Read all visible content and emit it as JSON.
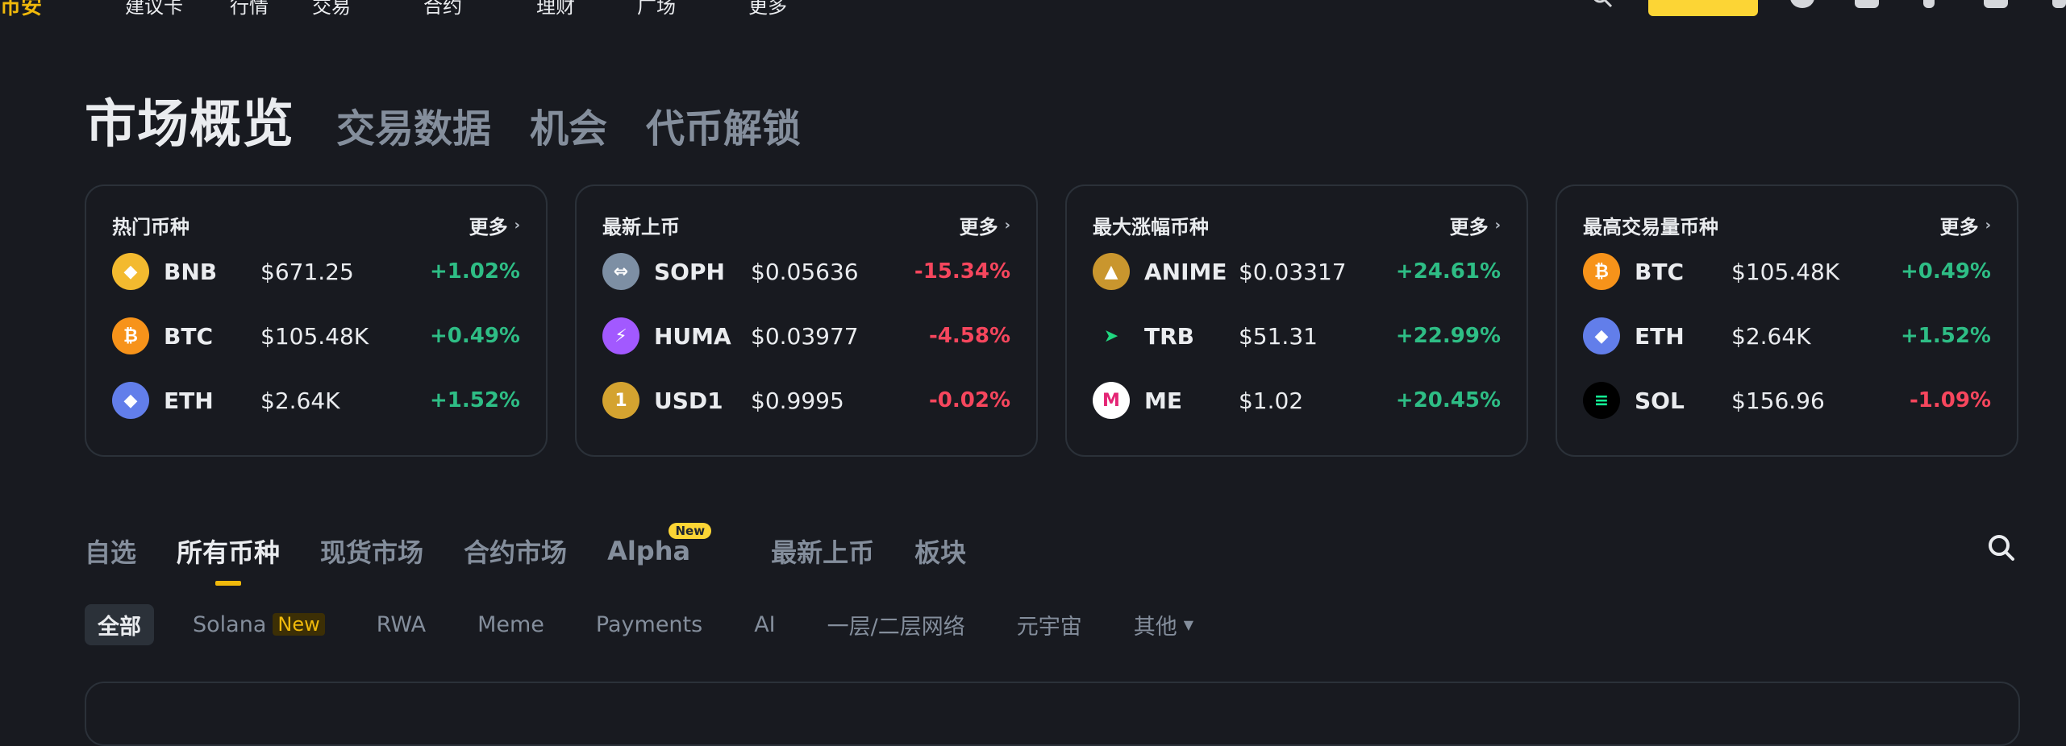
{
  "nav": {
    "logo": "币安",
    "items": [
      "建议卡",
      "行情",
      "交易",
      "合约",
      "理财",
      "广场",
      "更多"
    ]
  },
  "header": {
    "title": "市场概览",
    "tabs": [
      "交易数据",
      "机会",
      "代币解锁"
    ]
  },
  "cards": [
    {
      "title": "热门币种",
      "more": "更多",
      "rows": [
        {
          "symbol": "BNB",
          "price": "$671.25",
          "change": "+1.02%",
          "dir": "up",
          "icon": "bnb-icon",
          "color": "#f3ba2f"
        },
        {
          "symbol": "BTC",
          "price": "$105.48K",
          "change": "+0.49%",
          "dir": "up",
          "icon": "btc-icon",
          "color": "#f7931a"
        },
        {
          "symbol": "ETH",
          "price": "$2.64K",
          "change": "+1.52%",
          "dir": "up",
          "icon": "eth-icon",
          "color": "#627eea"
        }
      ]
    },
    {
      "title": "最新上币",
      "more": "更多",
      "rows": [
        {
          "symbol": "SOPH",
          "price": "$0.05636",
          "change": "-15.34%",
          "dir": "down",
          "icon": "soph-icon",
          "color": "#7d8fa4"
        },
        {
          "symbol": "HUMA",
          "price": "$0.03977",
          "change": "-4.58%",
          "dir": "down",
          "icon": "huma-icon",
          "color": "#a259ff"
        },
        {
          "symbol": "USD1",
          "price": "$0.9995",
          "change": "-0.02%",
          "dir": "down",
          "icon": "usd1-icon",
          "color": "#d4a330"
        }
      ]
    },
    {
      "title": "最大涨幅币种",
      "more": "更多",
      "rows": [
        {
          "symbol": "ANIME",
          "price": "$0.03317",
          "change": "+24.61%",
          "dir": "up",
          "icon": "anime-icon",
          "color": "#c9962e"
        },
        {
          "symbol": "TRB",
          "price": "$51.31",
          "change": "+22.99%",
          "dir": "up",
          "icon": "trb-icon",
          "color": "#20d67f"
        },
        {
          "symbol": "ME",
          "price": "$1.02",
          "change": "+20.45%",
          "dir": "up",
          "icon": "me-icon",
          "color": "#ffffff"
        }
      ]
    },
    {
      "title": "最高交易量币种",
      "more": "更多",
      "rows": [
        {
          "symbol": "BTC",
          "price": "$105.48K",
          "change": "+0.49%",
          "dir": "up",
          "icon": "btc-icon",
          "color": "#f7931a"
        },
        {
          "symbol": "ETH",
          "price": "$2.64K",
          "change": "+1.52%",
          "dir": "up",
          "icon": "eth-icon",
          "color": "#627eea"
        },
        {
          "symbol": "SOL",
          "price": "$156.96",
          "change": "-1.09%",
          "dir": "down",
          "icon": "sol-icon",
          "color": "#000000"
        }
      ]
    }
  ],
  "market_tabs": {
    "items": [
      "自选",
      "所有币种",
      "现货市场",
      "合约市场",
      "Alpha",
      "最新上币",
      "板块"
    ],
    "active": "所有币种",
    "alpha_badge": "New"
  },
  "chips": {
    "items": [
      "全部",
      "Solana",
      "RWA",
      "Meme",
      "Payments",
      "AI",
      "一层/二层网络",
      "元宇宙",
      "其他"
    ],
    "active": "全部",
    "solana_badge": "New"
  },
  "colors": {
    "up": "#2ebd85",
    "down": "#f6465d",
    "accent": "#f0b90b",
    "badge": "#fcd535"
  }
}
